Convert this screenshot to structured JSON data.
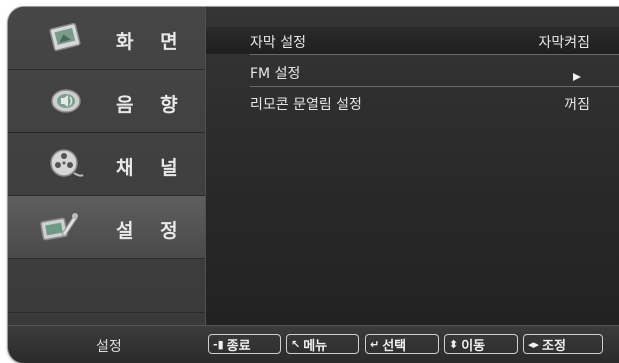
{
  "sidebar": {
    "items": [
      {
        "label": "화 면",
        "icon": "picture-icon"
      },
      {
        "label": "음 향",
        "icon": "speaker-icon"
      },
      {
        "label": "채 널",
        "icon": "film-reel-icon"
      },
      {
        "label": "설 정",
        "icon": "settings-wrench-icon",
        "selected": true
      }
    ]
  },
  "settings": {
    "rows": [
      {
        "label": "자막 설정",
        "value": "자막켜짐",
        "highlighted": true
      },
      {
        "label": "FM 설정",
        "value": "",
        "icon": "arrow-right-icon"
      },
      {
        "label": "리모콘 문열림 설정",
        "value": "꺼짐"
      }
    ]
  },
  "bottom": {
    "section_label": "설정",
    "hints": [
      {
        "icon": "-▮",
        "label": "종료"
      },
      {
        "icon": "↖",
        "label": "메뉴"
      },
      {
        "icon": "↵",
        "label": "선택"
      },
      {
        "icon": "⬍",
        "label": "이동"
      },
      {
        "icon": "◂▸",
        "label": "조정"
      }
    ]
  },
  "colors": {
    "background": "#2a2a2a",
    "sidebar": "#404040",
    "text": "#e6e6e6"
  }
}
